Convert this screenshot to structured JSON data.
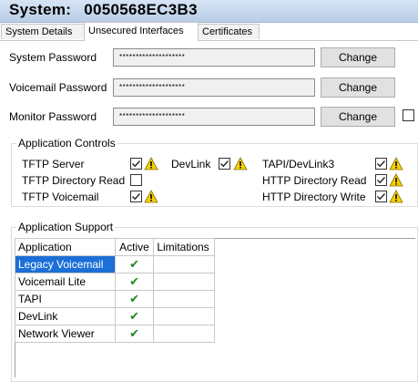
{
  "title": {
    "label": "System:",
    "value": "0050568EC3B3"
  },
  "tabs": [
    {
      "label": "System Details",
      "active": false
    },
    {
      "label": "Unsecured Interfaces",
      "active": true
    },
    {
      "label": "Certificates",
      "active": false
    }
  ],
  "passwords": [
    {
      "label": "System Password",
      "value": "********************",
      "button": "Change"
    },
    {
      "label": "Voicemail Password",
      "value": "********************",
      "button": "Change"
    },
    {
      "label": "Monitor Password",
      "value": "********************",
      "button": "Change"
    }
  ],
  "app_controls": {
    "title": "Application Controls",
    "items": [
      {
        "label": "TFTP Server",
        "checked": true,
        "warning": true
      },
      {
        "label": "TFTP Directory Read",
        "checked": false,
        "warning": false
      },
      {
        "label": "TFTP Voicemail",
        "checked": true,
        "warning": true
      },
      {
        "label": "DevLink",
        "checked": true,
        "warning": true
      },
      {
        "label": "TAPI/DevLink3",
        "checked": true,
        "warning": true
      },
      {
        "label": "HTTP Directory Read",
        "checked": true,
        "warning": true
      },
      {
        "label": "HTTP Directory Write",
        "checked": true,
        "warning": true
      }
    ]
  },
  "app_support": {
    "title": "Application Support",
    "columns": [
      "Application",
      "Active",
      "Limitations"
    ],
    "rows": [
      {
        "application": "Legacy Voicemail",
        "active": "✔",
        "limitations": "",
        "selected": true
      },
      {
        "application": "Voicemail Lite",
        "active": "✔",
        "limitations": "",
        "selected": false
      },
      {
        "application": "TAPI",
        "active": "✔",
        "limitations": "",
        "selected": false
      },
      {
        "application": "DevLink",
        "active": "✔",
        "limitations": "",
        "selected": false
      },
      {
        "application": "Network Viewer",
        "active": "✔",
        "limitations": "",
        "selected": false
      }
    ]
  },
  "colors": {
    "selection": "#1c6fd6",
    "check": "#1e8a1e",
    "warning": "#f5d000"
  }
}
